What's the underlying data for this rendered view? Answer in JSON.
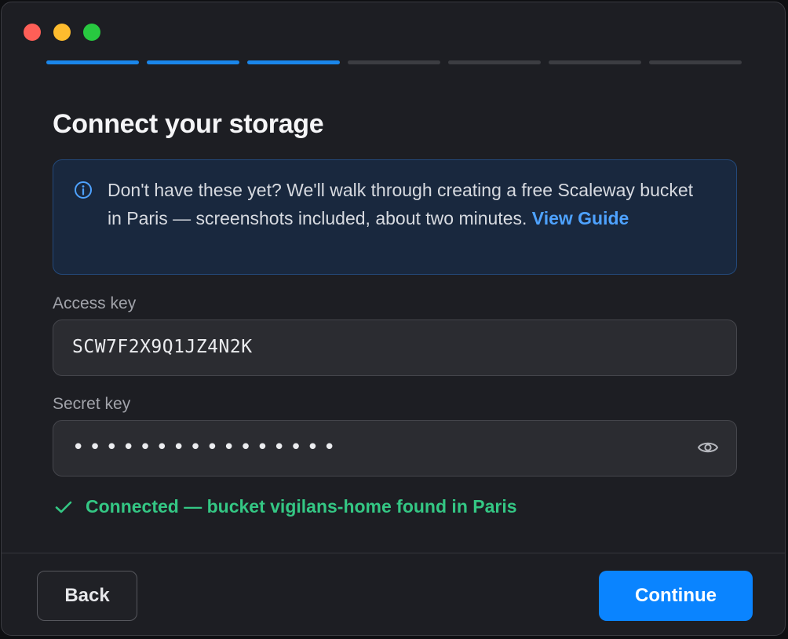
{
  "wizard": {
    "total_steps": 7,
    "completed_steps": 3
  },
  "title": "Connect your storage",
  "info": {
    "text": "Don't have these yet? We'll walk through creating a free Scaleway bucket in Paris — screenshots included, about two minutes.",
    "link_label": "View Guide",
    "icon": "info-circle-icon"
  },
  "access_key": {
    "label": "Access key",
    "value": "SCW7F2X9Q1JZ4N2K"
  },
  "secret_key": {
    "label": "Secret key",
    "masked_value": "••••••••••••••••",
    "toggle_icon": "eye-icon"
  },
  "status": {
    "text": "Connected — bucket vigilans-home found in Paris",
    "icon": "checkmark-icon",
    "color": "#34c784"
  },
  "footer": {
    "back_label": "Back",
    "continue_label": "Continue"
  },
  "colors": {
    "accent": "#0a84ff",
    "link": "#4ea2ff",
    "success": "#34c784"
  }
}
